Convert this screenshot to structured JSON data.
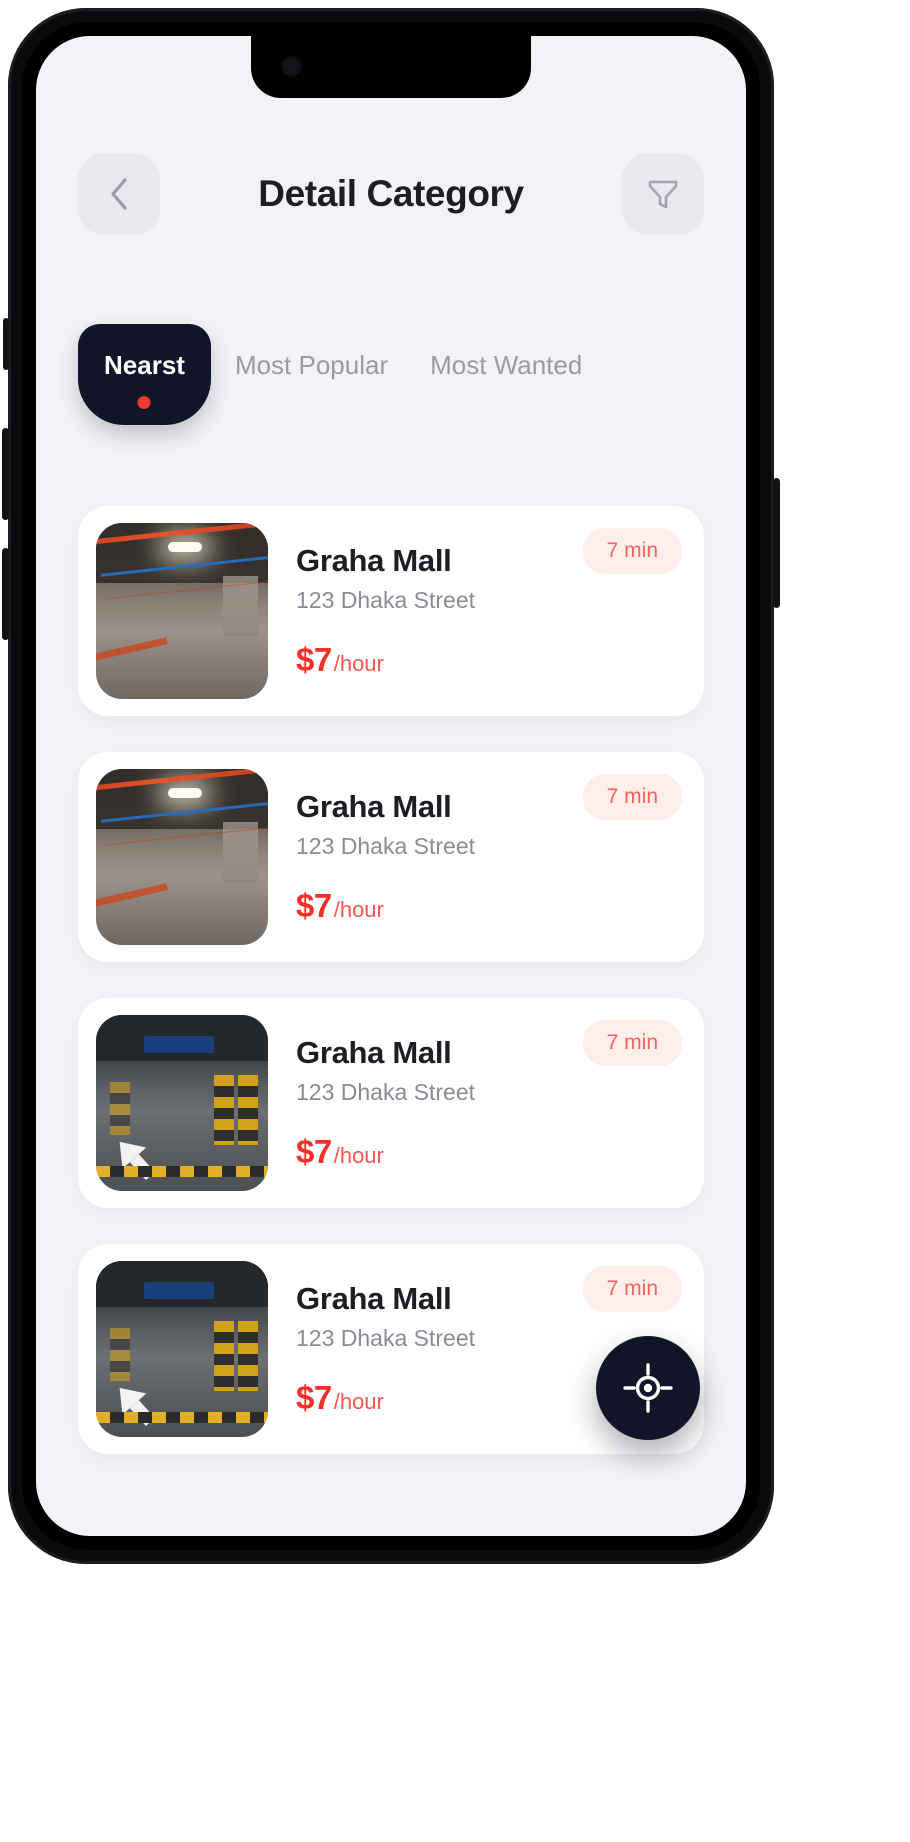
{
  "header": {
    "title": "Detail Category",
    "back_icon": "chevron-left-icon",
    "filter_icon": "funnel-filter-icon"
  },
  "tabs": [
    {
      "label": "Nearst",
      "active": true
    },
    {
      "label": "Most Popular",
      "active": false
    },
    {
      "label": "Most Wanted",
      "active": false
    }
  ],
  "cards": [
    {
      "name": "Graha Mall",
      "address": "123 Dhaka Street",
      "price_amount": "$7",
      "price_unit": "/hour",
      "time_badge": "7 min",
      "thumb_style": "garage-a"
    },
    {
      "name": "Graha Mall",
      "address": "123 Dhaka Street",
      "price_amount": "$7",
      "price_unit": "/hour",
      "time_badge": "7 min",
      "thumb_style": "garage-a"
    },
    {
      "name": "Graha Mall",
      "address": "123 Dhaka Street",
      "price_amount": "$7",
      "price_unit": "/hour",
      "time_badge": "7 min",
      "thumb_style": "garage-b"
    },
    {
      "name": "Graha Mall",
      "address": "123 Dhaka Street",
      "price_amount": "$7",
      "price_unit": "/hour",
      "time_badge": "7 min",
      "thumb_style": "garage-b"
    }
  ],
  "fab": {
    "icon": "gps-locate-icon"
  },
  "colors": {
    "screen_background": "#f3f3f7",
    "card_background": "#ffffff",
    "dark_navy": "#121527",
    "accent_red": "#f2302a",
    "badge_background": "#fdeeec",
    "badge_text": "#f4645c",
    "muted_text": "#8b8b97",
    "title_text": "#1d1d24",
    "header_button_background": "#e8e8ef"
  }
}
